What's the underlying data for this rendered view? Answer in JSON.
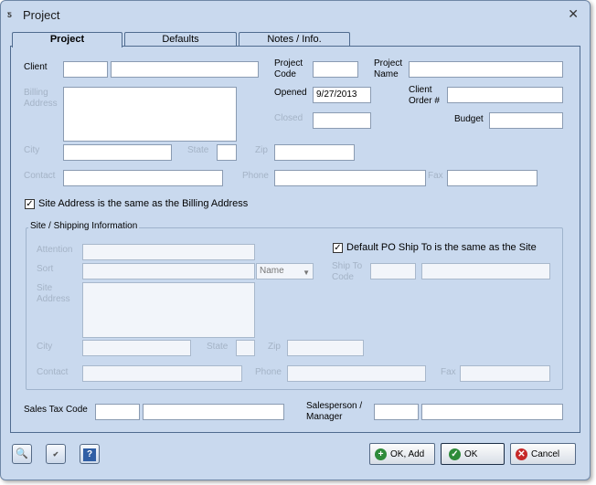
{
  "window": {
    "title": "Project",
    "icon": "app-icon",
    "close": "close-icon"
  },
  "tabs": [
    {
      "label": "Project",
      "active": true
    },
    {
      "label": "Defaults",
      "active": false
    },
    {
      "label": "Notes / Info.",
      "active": false
    }
  ],
  "project": {
    "client_label": "Client",
    "billing_address_label": "Billing Address",
    "city_label": "City",
    "state_label": "State",
    "zip_label": "Zip",
    "contact_label": "Contact",
    "phone_label": "Phone",
    "fax_label": "Fax",
    "project_code_label": "Project Code",
    "project_name_label": "Project Name",
    "opened_label": "Opened",
    "opened_value": "9/27/2013",
    "client_order_label": "Client Order #",
    "closed_label": "Closed",
    "budget_label": "Budget",
    "site_same_label": "Site Address is the same as the Billing Address",
    "site_same_checked": true
  },
  "site": {
    "group_title": "Site / Shipping Information",
    "attention_label": "Attention",
    "sort_label": "Sort",
    "sort_select_value": "Name",
    "site_address_label": "Site Address",
    "city_label": "City",
    "state_label": "State",
    "zip_label": "Zip",
    "contact_label": "Contact",
    "phone_label": "Phone",
    "fax_label": "Fax",
    "default_po_label": "Default PO Ship To is the same as the Site",
    "default_po_checked": true,
    "ship_to_code_label": "Ship To Code"
  },
  "footer": {
    "sales_tax_label": "Sales Tax Code",
    "salesperson_label": "Salesperson / Manager"
  },
  "toolbar": {
    "lookup_icon": "search-icon",
    "spellcheck_icon": "spellcheck-icon",
    "help_icon": "help-icon"
  },
  "actions": {
    "ok_add": "OK, Add",
    "ok": "OK",
    "cancel": "Cancel"
  },
  "colors": {
    "background": "#c9d9ee",
    "ok_green": "#2e8b3a",
    "cancel_red": "#c62828"
  }
}
